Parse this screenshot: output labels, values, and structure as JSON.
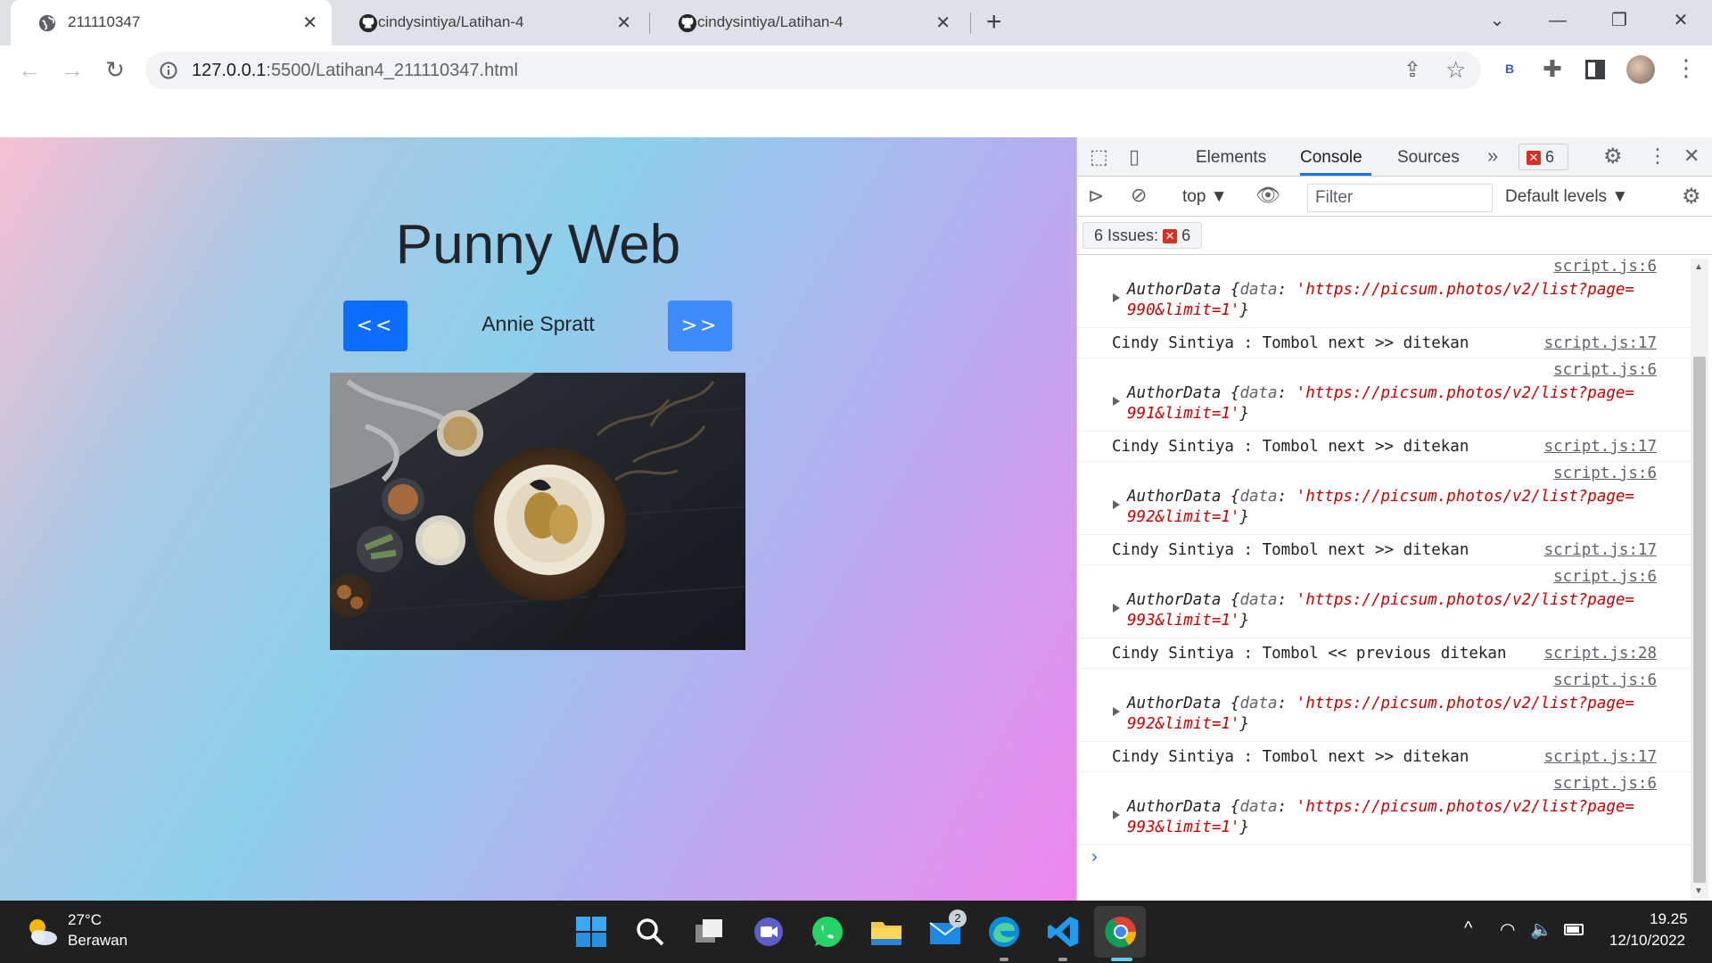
{
  "browser": {
    "tabs": [
      {
        "label": "211110347",
        "icon": "globe-icon",
        "active": true
      },
      {
        "label": "cindysintiya/Latihan-4",
        "icon": "github-icon",
        "active": false
      },
      {
        "label": "cindysintiya/Latihan-4",
        "icon": "github-icon",
        "active": false
      }
    ],
    "new_tab_label": "+",
    "url_host": "127.0.0.1",
    "url_rest": ":5500/Latihan4_211110347.html",
    "extension_badge": "B"
  },
  "page": {
    "title": "Punny Web",
    "prev_label": "<<",
    "next_label": ">>",
    "author": "Annie Spratt"
  },
  "devtools": {
    "tabs": [
      "Elements",
      "Console",
      "Sources"
    ],
    "active_tab": "Console",
    "more_tabs": "»",
    "error_count": "6",
    "context": "top",
    "filter_placeholder": "Filter",
    "levels": "Default levels",
    "issues_label": "6 Issues:",
    "issues_count": "6",
    "log": [
      {
        "kind": "obj",
        "src": "script.js:6",
        "prefix": "AuthorData {",
        "key": "data",
        "url1": "'https://picsum.photos/v2/list?page=",
        "url2": "990&limit=1'",
        "suffix": "}"
      },
      {
        "kind": "text",
        "src": "script.js:17",
        "text": "Cindy Sintiya : Tombol next >> ditekan"
      },
      {
        "kind": "obj",
        "src": "script.js:6",
        "prefix": "AuthorData {",
        "key": "data",
        "url1": "'https://picsum.photos/v2/list?page=",
        "url2": "991&limit=1'",
        "suffix": "}"
      },
      {
        "kind": "text",
        "src": "script.js:17",
        "text": "Cindy Sintiya : Tombol next >> ditekan"
      },
      {
        "kind": "obj",
        "src": "script.js:6",
        "prefix": "AuthorData {",
        "key": "data",
        "url1": "'https://picsum.photos/v2/list?page=",
        "url2": "992&limit=1'",
        "suffix": "}"
      },
      {
        "kind": "text",
        "src": "script.js:17",
        "text": "Cindy Sintiya : Tombol next >> ditekan"
      },
      {
        "kind": "obj",
        "src": "script.js:6",
        "prefix": "AuthorData {",
        "key": "data",
        "url1": "'https://picsum.photos/v2/list?page=",
        "url2": "993&limit=1'",
        "suffix": "}"
      },
      {
        "kind": "text",
        "src": "script.js:28",
        "text": "Cindy Sintiya : Tombol << previous ditekan"
      },
      {
        "kind": "obj",
        "src": "script.js:6",
        "prefix": "AuthorData {",
        "key": "data",
        "url1": "'https://picsum.photos/v2/list?page=",
        "url2": "992&limit=1'",
        "suffix": "}"
      },
      {
        "kind": "text",
        "src": "script.js:17",
        "text": "Cindy Sintiya : Tombol next >> ditekan"
      },
      {
        "kind": "obj",
        "src": "script.js:6",
        "prefix": "AuthorData {",
        "key": "data",
        "url1": "'https://picsum.photos/v2/list?page=",
        "url2": "993&limit=1'",
        "suffix": "}"
      }
    ]
  },
  "taskbar": {
    "weather_temp": "27°C",
    "weather_desc": "Berawan",
    "mail_badge": "2",
    "time": "19.25",
    "date": "12/10/2022"
  }
}
